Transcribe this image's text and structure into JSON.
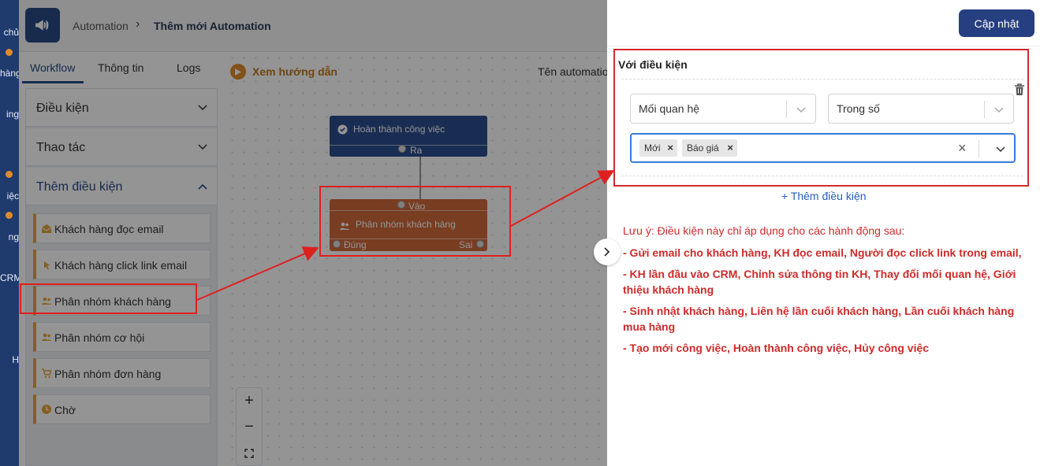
{
  "leftnav": {
    "labels": [
      "chủ",
      "hàng",
      "ing",
      "iệc",
      "ng",
      "CRM",
      "H"
    ]
  },
  "header": {
    "breadcrumb_root": "Automation",
    "breadcrumb_current": "Thêm mới Automation"
  },
  "tabs": [
    {
      "label": "Workflow"
    },
    {
      "label": "Thông tin"
    },
    {
      "label": "Logs"
    }
  ],
  "sidebar": {
    "sections": [
      {
        "label": "Điều kiện"
      },
      {
        "label": "Thao tác"
      },
      {
        "label": "Thêm điều kiện"
      }
    ],
    "items": [
      {
        "label": "Khách hàng đọc email",
        "icon": "envelope-open-icon"
      },
      {
        "label": "Khách hàng click link email",
        "icon": "cursor-click-icon"
      },
      {
        "label": "Phân nhóm khách hàng",
        "icon": "users-icon"
      },
      {
        "label": "Phân nhóm cơ hội",
        "icon": "users-icon"
      },
      {
        "label": "Phân nhóm đơn hàng",
        "icon": "cart-icon"
      },
      {
        "label": "Chờ",
        "icon": "clock-icon"
      }
    ]
  },
  "canvas": {
    "guide": "Xem hướng dẫn",
    "automation_name_label": "Tên automation",
    "node1": {
      "title": "Hoàn thành công việc",
      "port_out": "Ra"
    },
    "node2": {
      "title": "Phân nhóm khách hàng",
      "port_in": "Vào",
      "port_true": "Đúng",
      "port_false": "Sai"
    }
  },
  "panel": {
    "update_button": "Cập nhật",
    "condition_title": "Với điều kiện",
    "select1": "Mối quan hệ",
    "select2": "Trong số",
    "tags": [
      "Mới",
      "Báo giá"
    ],
    "add_condition": "+ Thêm điều kiện",
    "note_title": "Lưu ý: Điều kiện này chỉ áp dụng cho các hành động sau:",
    "notes": [
      "- Gửi email cho khách hàng, KH đọc email, Người đọc click link trong email,",
      "- KH lần đầu vào CRM, Chỉnh sửa thông tin KH, Thay đổi mối quan hệ, Giới thiệu khách hàng",
      "- Sinh nhật khách hàng, Liên hệ lần cuối khách hàng, Lần cuối khách hàng mua hàng",
      "- Tạo mới công việc, Hoàn thành công việc, Hủy công việc"
    ]
  },
  "colors": {
    "brand": "#263f80",
    "accent": "#e08a2a",
    "annotation": "#e01f1f",
    "note": "#cf2a2a"
  }
}
